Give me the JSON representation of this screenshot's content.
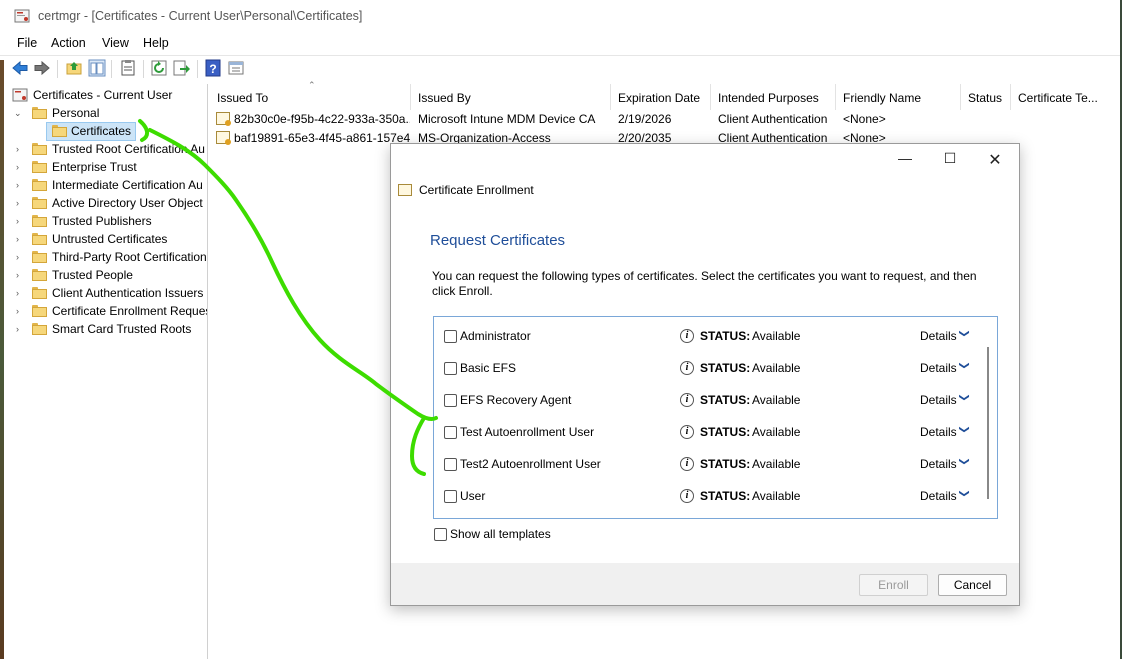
{
  "window": {
    "title": "certmgr - [Certificates - Current User\\Personal\\Certificates]"
  },
  "menu": [
    "File",
    "Action",
    "View",
    "Help"
  ],
  "toolbar_icons": [
    "back-arrow-icon",
    "forward-arrow-icon",
    "up-folder-icon",
    "show-hide-tree-icon",
    "properties-icon",
    "refresh-icon",
    "export-list-icon",
    "help-icon",
    "mmc-view-icon"
  ],
  "tree": {
    "root": "Certificates - Current User",
    "personal": "Personal",
    "certificates": "Certificates",
    "items": [
      "Trusted Root Certification Au",
      "Enterprise Trust",
      "Intermediate Certification Au",
      "Active Directory User Object",
      "Trusted Publishers",
      "Untrusted Certificates",
      "Third-Party Root Certification",
      "Trusted People",
      "Client Authentication Issuers",
      "Certificate Enrollment Reques",
      "Smart Card Trusted Roots"
    ]
  },
  "list": {
    "columns": [
      "Issued To",
      "Issued By",
      "Expiration Date",
      "Intended Purposes",
      "Friendly Name",
      "Status",
      "Certificate Te..."
    ],
    "rows": [
      [
        "82b30c0e-f95b-4c22-933a-350a...",
        "Microsoft Intune MDM Device CA",
        "2/19/2026",
        "Client Authentication",
        "<None>"
      ],
      [
        "baf19891-65e3-4f45-a861-157e4...",
        "MS-Organization-Access",
        "2/20/2035",
        "Client Authentication",
        "<None>"
      ]
    ]
  },
  "dialog": {
    "title": "Certificate Enrollment",
    "heading": "Request Certificates",
    "description": "You can request the following types of certificates. Select the certificates you want to request, and then click Enroll.",
    "status_label": "STATUS:",
    "details_label": "Details",
    "templates": [
      {
        "name": "Administrator",
        "status": "Available"
      },
      {
        "name": "Basic EFS",
        "status": "Available"
      },
      {
        "name": "EFS Recovery Agent",
        "status": "Available"
      },
      {
        "name": "Test Autoenrollment User",
        "status": "Available"
      },
      {
        "name": "Test2 Autoenrollment User",
        "status": "Available"
      },
      {
        "name": "User",
        "status": "Available"
      }
    ],
    "show_all": "Show all templates",
    "enroll": "Enroll",
    "cancel": "Cancel"
  },
  "colors": {
    "heading": "#1f4e99",
    "annotation": "#3ddc00",
    "selection": "#cce4f7"
  }
}
